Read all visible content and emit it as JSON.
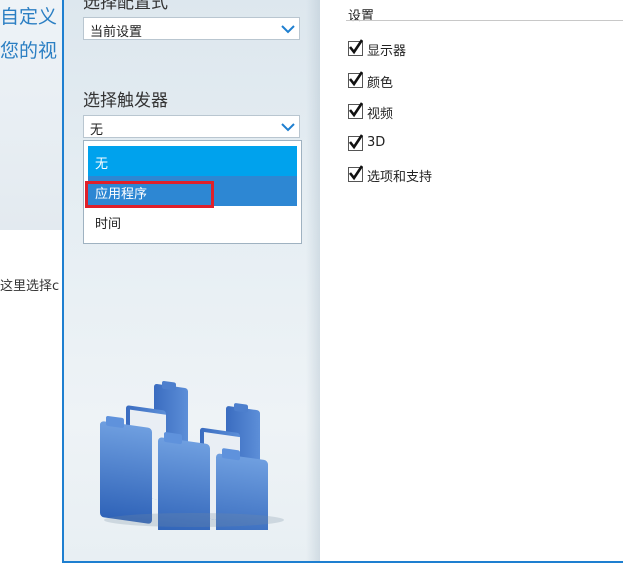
{
  "background_page": {
    "hero_line1": "自定义",
    "hero_line2": "您的视",
    "body_text": "这里选择c"
  },
  "dialog": {
    "profile": {
      "label": "选择配置式",
      "value": "当前设置"
    },
    "trigger": {
      "label": "选择触发器",
      "value": "无",
      "options": [
        "无",
        "应用程序",
        "时间"
      ],
      "selected_index": 0,
      "hovered_index": 1
    },
    "settings": {
      "title": "设置",
      "items": [
        {
          "label": "显示器",
          "checked": true
        },
        {
          "label": "颜色",
          "checked": true
        },
        {
          "label": "视频",
          "checked": true
        },
        {
          "label": "3D",
          "checked": true
        },
        {
          "label": "选项和支持",
          "checked": true
        }
      ]
    }
  },
  "colors": {
    "accent": "#1e7fd0",
    "selected_option": "#00a2ed",
    "hovered_option": "#2d87d3",
    "annotation": "#e0202a"
  },
  "icons": {
    "dropdown": "chevron-down-icon",
    "illustration": "folders-illustration"
  }
}
